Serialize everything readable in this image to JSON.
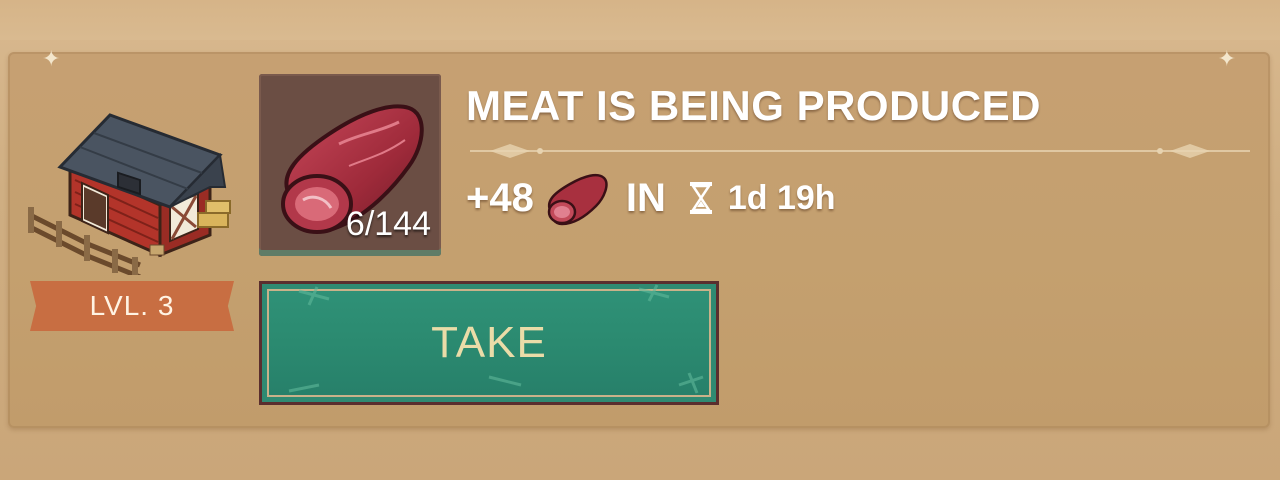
{
  "building": {
    "name_icon": "barn-icon",
    "level_label": "LVL. 3"
  },
  "production": {
    "title": "MEAT IS BEING PRODUCED",
    "resource_icon": "meat-icon",
    "stock_count": "6/144",
    "amount": "+48",
    "in_label": "IN",
    "timer_icon": "hourglass-icon",
    "time_remaining": "1d 19h"
  },
  "actions": {
    "take_label": "TAKE"
  },
  "colors": {
    "panel": "#c4a06f",
    "button": "#2b8a70",
    "button_text": "#eadca8",
    "ribbon": "#c86e42"
  }
}
